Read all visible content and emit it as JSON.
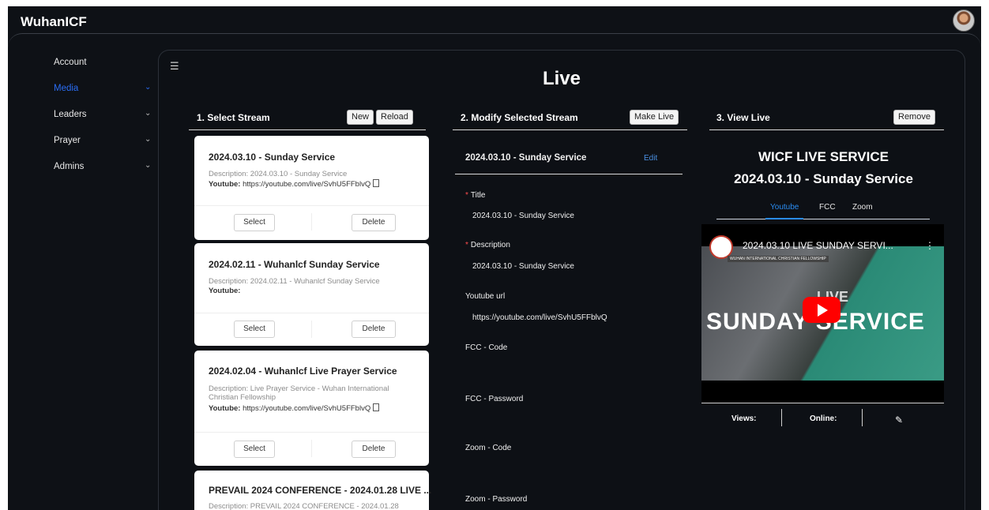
{
  "app": {
    "brand": "WuhanICF"
  },
  "sidebar": {
    "items": [
      {
        "label": "Account",
        "has_chevron": false,
        "active": false
      },
      {
        "label": "Media",
        "has_chevron": true,
        "active": true
      },
      {
        "label": "Leaders",
        "has_chevron": true,
        "active": false
      },
      {
        "label": "Prayer",
        "has_chevron": true,
        "active": false
      },
      {
        "label": "Admins",
        "has_chevron": true,
        "active": false
      }
    ],
    "chevron": "⌄"
  },
  "page": {
    "title": "Live",
    "menu_icon": "☰"
  },
  "select_stream": {
    "heading": "1. Select Stream",
    "new_label": "New",
    "reload_label": "Reload",
    "cards": [
      {
        "title": "2024.03.10 - Sunday Service",
        "description": "Description: 2024.03.10 - Sunday Service",
        "youtube_label": "Youtube:",
        "youtube_url": "https://youtube.com/live/SvhU5FFblvQ",
        "select_label": "Select",
        "delete_label": "Delete"
      },
      {
        "title": "2024.02.11 - Wuhanlcf Sunday Service",
        "description": "Description: 2024.02.11 - Wuhanlcf Sunday Service",
        "youtube_label": "Youtube:",
        "youtube_url": "",
        "select_label": "Select",
        "delete_label": "Delete"
      },
      {
        "title": "2024.02.04 - Wuhanlcf Live Prayer Service",
        "description": "Description: Live Prayer Service - Wuhan International Christian Fellowship",
        "youtube_label": "Youtube:",
        "youtube_url": "https://youtube.com/live/SvhU5FFblvQ",
        "select_label": "Select",
        "delete_label": "Delete"
      },
      {
        "title": "PREVAIL 2024 CONFERENCE - 2024.01.28 LIVE ...",
        "description": "Description: PREVAIL 2024 CONFERENCE - 2024.01.28"
      }
    ]
  },
  "modify_stream": {
    "heading": "2. Modify Selected Stream",
    "make_live_label": "Make Live",
    "selected_title": "2024.03.10 - Sunday Service",
    "edit_label": "Edit",
    "title_label": "Title",
    "title_value": "2024.03.10 - Sunday Service",
    "description_label": "Description",
    "description_value": "2024.03.10 - Sunday Service",
    "youtube_label": "Youtube url",
    "youtube_value": "https://youtube.com/live/SvhU5FFblvQ",
    "fcc_code_label": "FCC - Code",
    "fcc_password_label": "FCC - Password",
    "zoom_code_label": "Zoom - Code",
    "zoom_password_label": "Zoom - Password"
  },
  "view_live": {
    "heading": "3. View Live",
    "remove_label": "Remove",
    "service_title": "WICF LIVE SERVICE",
    "service_subtitle": "2024.03.10 - Sunday Service",
    "tabs": [
      "Youtube",
      "FCC",
      "Zoom"
    ],
    "active_tab": "Youtube",
    "video": {
      "title": "2024.03.10 LIVE SUNDAY SERVI...",
      "channel": "WUHAN INTERNATIONAL CHRISTIAN FELLOWSHIP",
      "overlay_live": "LIVE",
      "overlay_text": "SUNDAY SERVICE"
    },
    "views_label": "Views:",
    "online_label": "Online:",
    "edit_icon": "✎"
  },
  "colors": {
    "accent": "#2a6df4",
    "background": "#0e1116",
    "required": "#ff4d4f",
    "youtube_red": "#ff0000"
  }
}
